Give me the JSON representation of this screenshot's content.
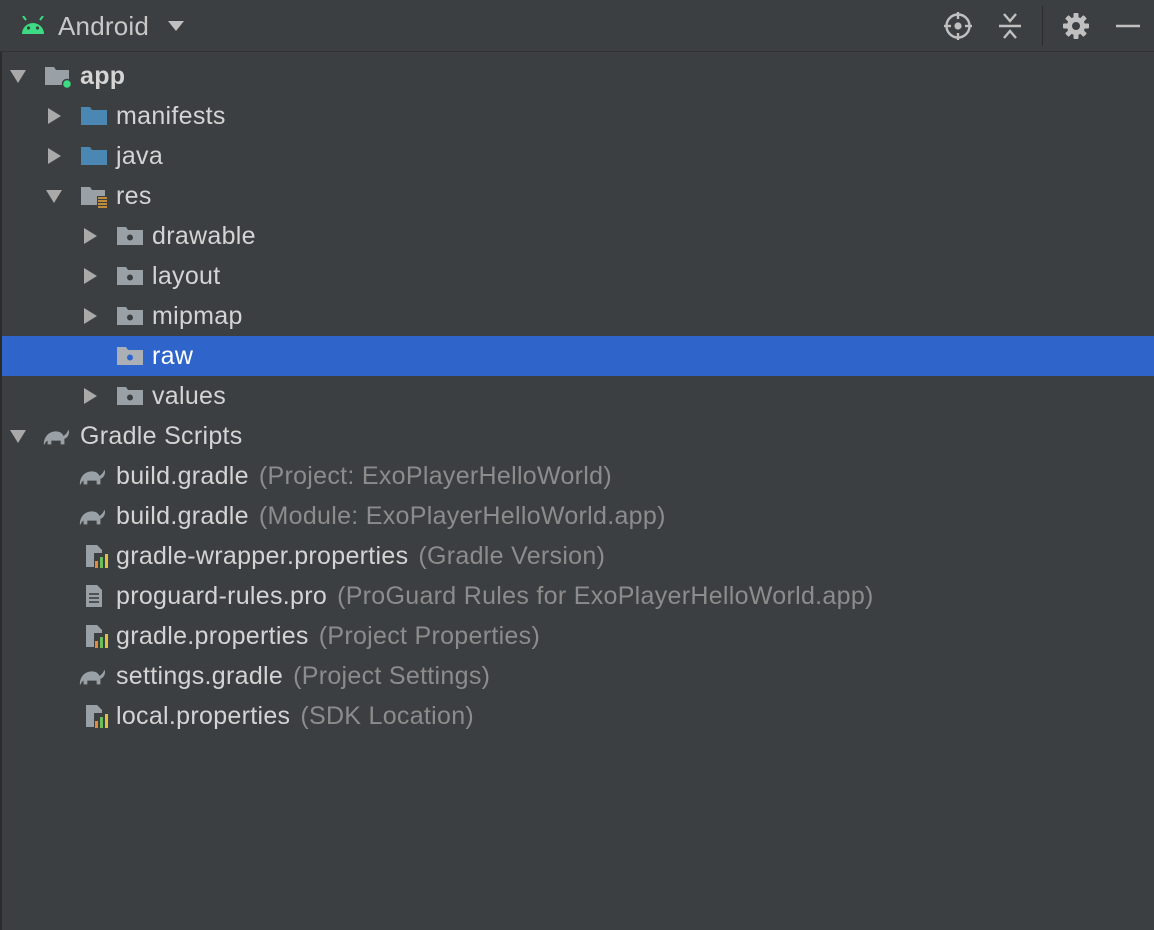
{
  "toolbar": {
    "view_label": "Android",
    "icons": [
      "android-icon",
      "chevron-down-icon",
      "locate-icon",
      "collapse-all-icon",
      "gear-icon",
      "minimize-icon"
    ]
  },
  "tree": {
    "app": "app",
    "manifests": "manifests",
    "java": "java",
    "res": "res",
    "drawable": "drawable",
    "layout": "layout",
    "mipmap": "mipmap",
    "raw": "raw",
    "values": "values",
    "gradle_scripts": "Gradle Scripts",
    "files": [
      {
        "name": "build.gradle",
        "hint": "(Project: ExoPlayerHelloWorld)"
      },
      {
        "name": "build.gradle",
        "hint": "(Module: ExoPlayerHelloWorld.app)"
      },
      {
        "name": "gradle-wrapper.properties",
        "hint": "(Gradle Version)"
      },
      {
        "name": "proguard-rules.pro",
        "hint": "(ProGuard Rules for ExoPlayerHelloWorld.app)"
      },
      {
        "name": "gradle.properties",
        "hint": "(Project Properties)"
      },
      {
        "name": "settings.gradle",
        "hint": "(Project Settings)"
      },
      {
        "name": "local.properties",
        "hint": "(SDK Location)"
      }
    ]
  },
  "colors": {
    "background": "#3c3f41",
    "selection": "#2f65ca",
    "android_green": "#3ddc84",
    "folder_blue": "#4a88b3",
    "folder_grey": "#9aa1a6",
    "hint_grey": "#8c8c8c"
  }
}
